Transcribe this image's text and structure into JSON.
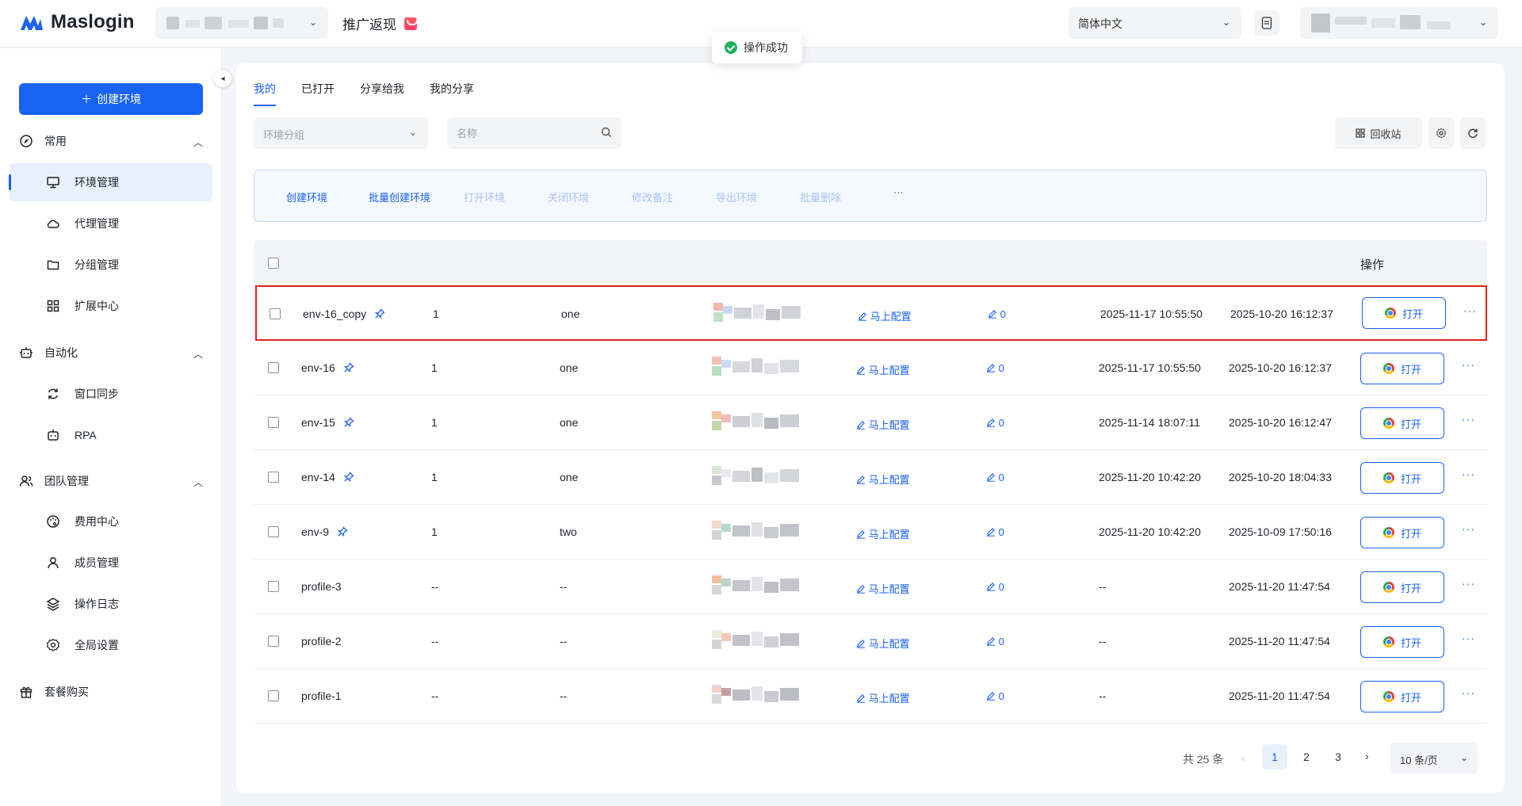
{
  "app": {
    "name": "Maslogin",
    "promo_label": "推广返现"
  },
  "header": {
    "language": "简体中文"
  },
  "toast": {
    "message": "操作成功"
  },
  "sidebar": {
    "create_button": "创建环境",
    "groups": [
      {
        "label": "常用",
        "items": [
          "环境管理",
          "代理管理",
          "分组管理",
          "扩展中心"
        ]
      },
      {
        "label": "自动化",
        "items": [
          "窗口同步",
          "RPA"
        ]
      },
      {
        "label": "团队管理",
        "items": [
          "费用中心",
          "成员管理",
          "操作日志",
          "全局设置"
        ]
      }
    ],
    "package_label": "套餐购买"
  },
  "tabs": [
    "我的",
    "已打开",
    "分享给我",
    "我的分享"
  ],
  "filters": {
    "group_placeholder": "环境分组",
    "name_placeholder": "名称",
    "recycle_label": "回收站"
  },
  "actions": [
    "创建环境",
    "批量创建环境",
    "打开环境",
    "关闭环境",
    "修改备注",
    "导出环境",
    "批量删除",
    "···"
  ],
  "table": {
    "ops_header": "操作",
    "config_label": "马上配置",
    "open_label": "打开",
    "more_label": "···",
    "rows": [
      {
        "name": "env-16_copy",
        "pinned": true,
        "num": "1",
        "group": "one",
        "notes": "0",
        "time1": "2025-11-17 10:55:50",
        "time2": "2025-10-20 16:12:37"
      },
      {
        "name": "env-16",
        "pinned": true,
        "num": "1",
        "group": "one",
        "notes": "0",
        "time1": "2025-11-17 10:55:50",
        "time2": "2025-10-20 16:12:37"
      },
      {
        "name": "env-15",
        "pinned": true,
        "num": "1",
        "group": "one",
        "notes": "0",
        "time1": "2025-11-14 18:07:11",
        "time2": "2025-10-20 16:12:47"
      },
      {
        "name": "env-14",
        "pinned": true,
        "num": "1",
        "group": "one",
        "notes": "0",
        "time1": "2025-11-20 10:42:20",
        "time2": "2025-10-20 18:04:33"
      },
      {
        "name": "env-9",
        "pinned": true,
        "num": "1",
        "group": "two",
        "notes": "0",
        "time1": "2025-11-20 10:42:20",
        "time2": "2025-10-09 17:50:16"
      },
      {
        "name": "profile-3",
        "pinned": false,
        "num": "--",
        "group": "--",
        "notes": "0",
        "time1": "--",
        "time2": "2025-11-20 11:47:54"
      },
      {
        "name": "profile-2",
        "pinned": false,
        "num": "--",
        "group": "--",
        "notes": "0",
        "time1": "--",
        "time2": "2025-11-20 11:47:54"
      },
      {
        "name": "profile-1",
        "pinned": false,
        "num": "--",
        "group": "--",
        "notes": "0",
        "time1": "--",
        "time2": "2025-11-20 11:47:54"
      }
    ]
  },
  "pagination": {
    "total": "共 25 条",
    "pages": [
      "1",
      "2",
      "3"
    ],
    "page_size": "10 条/页"
  },
  "colors": {
    "primary": "#1a62f2",
    "highlight_border": "#e02020",
    "success": "#1fb158"
  }
}
